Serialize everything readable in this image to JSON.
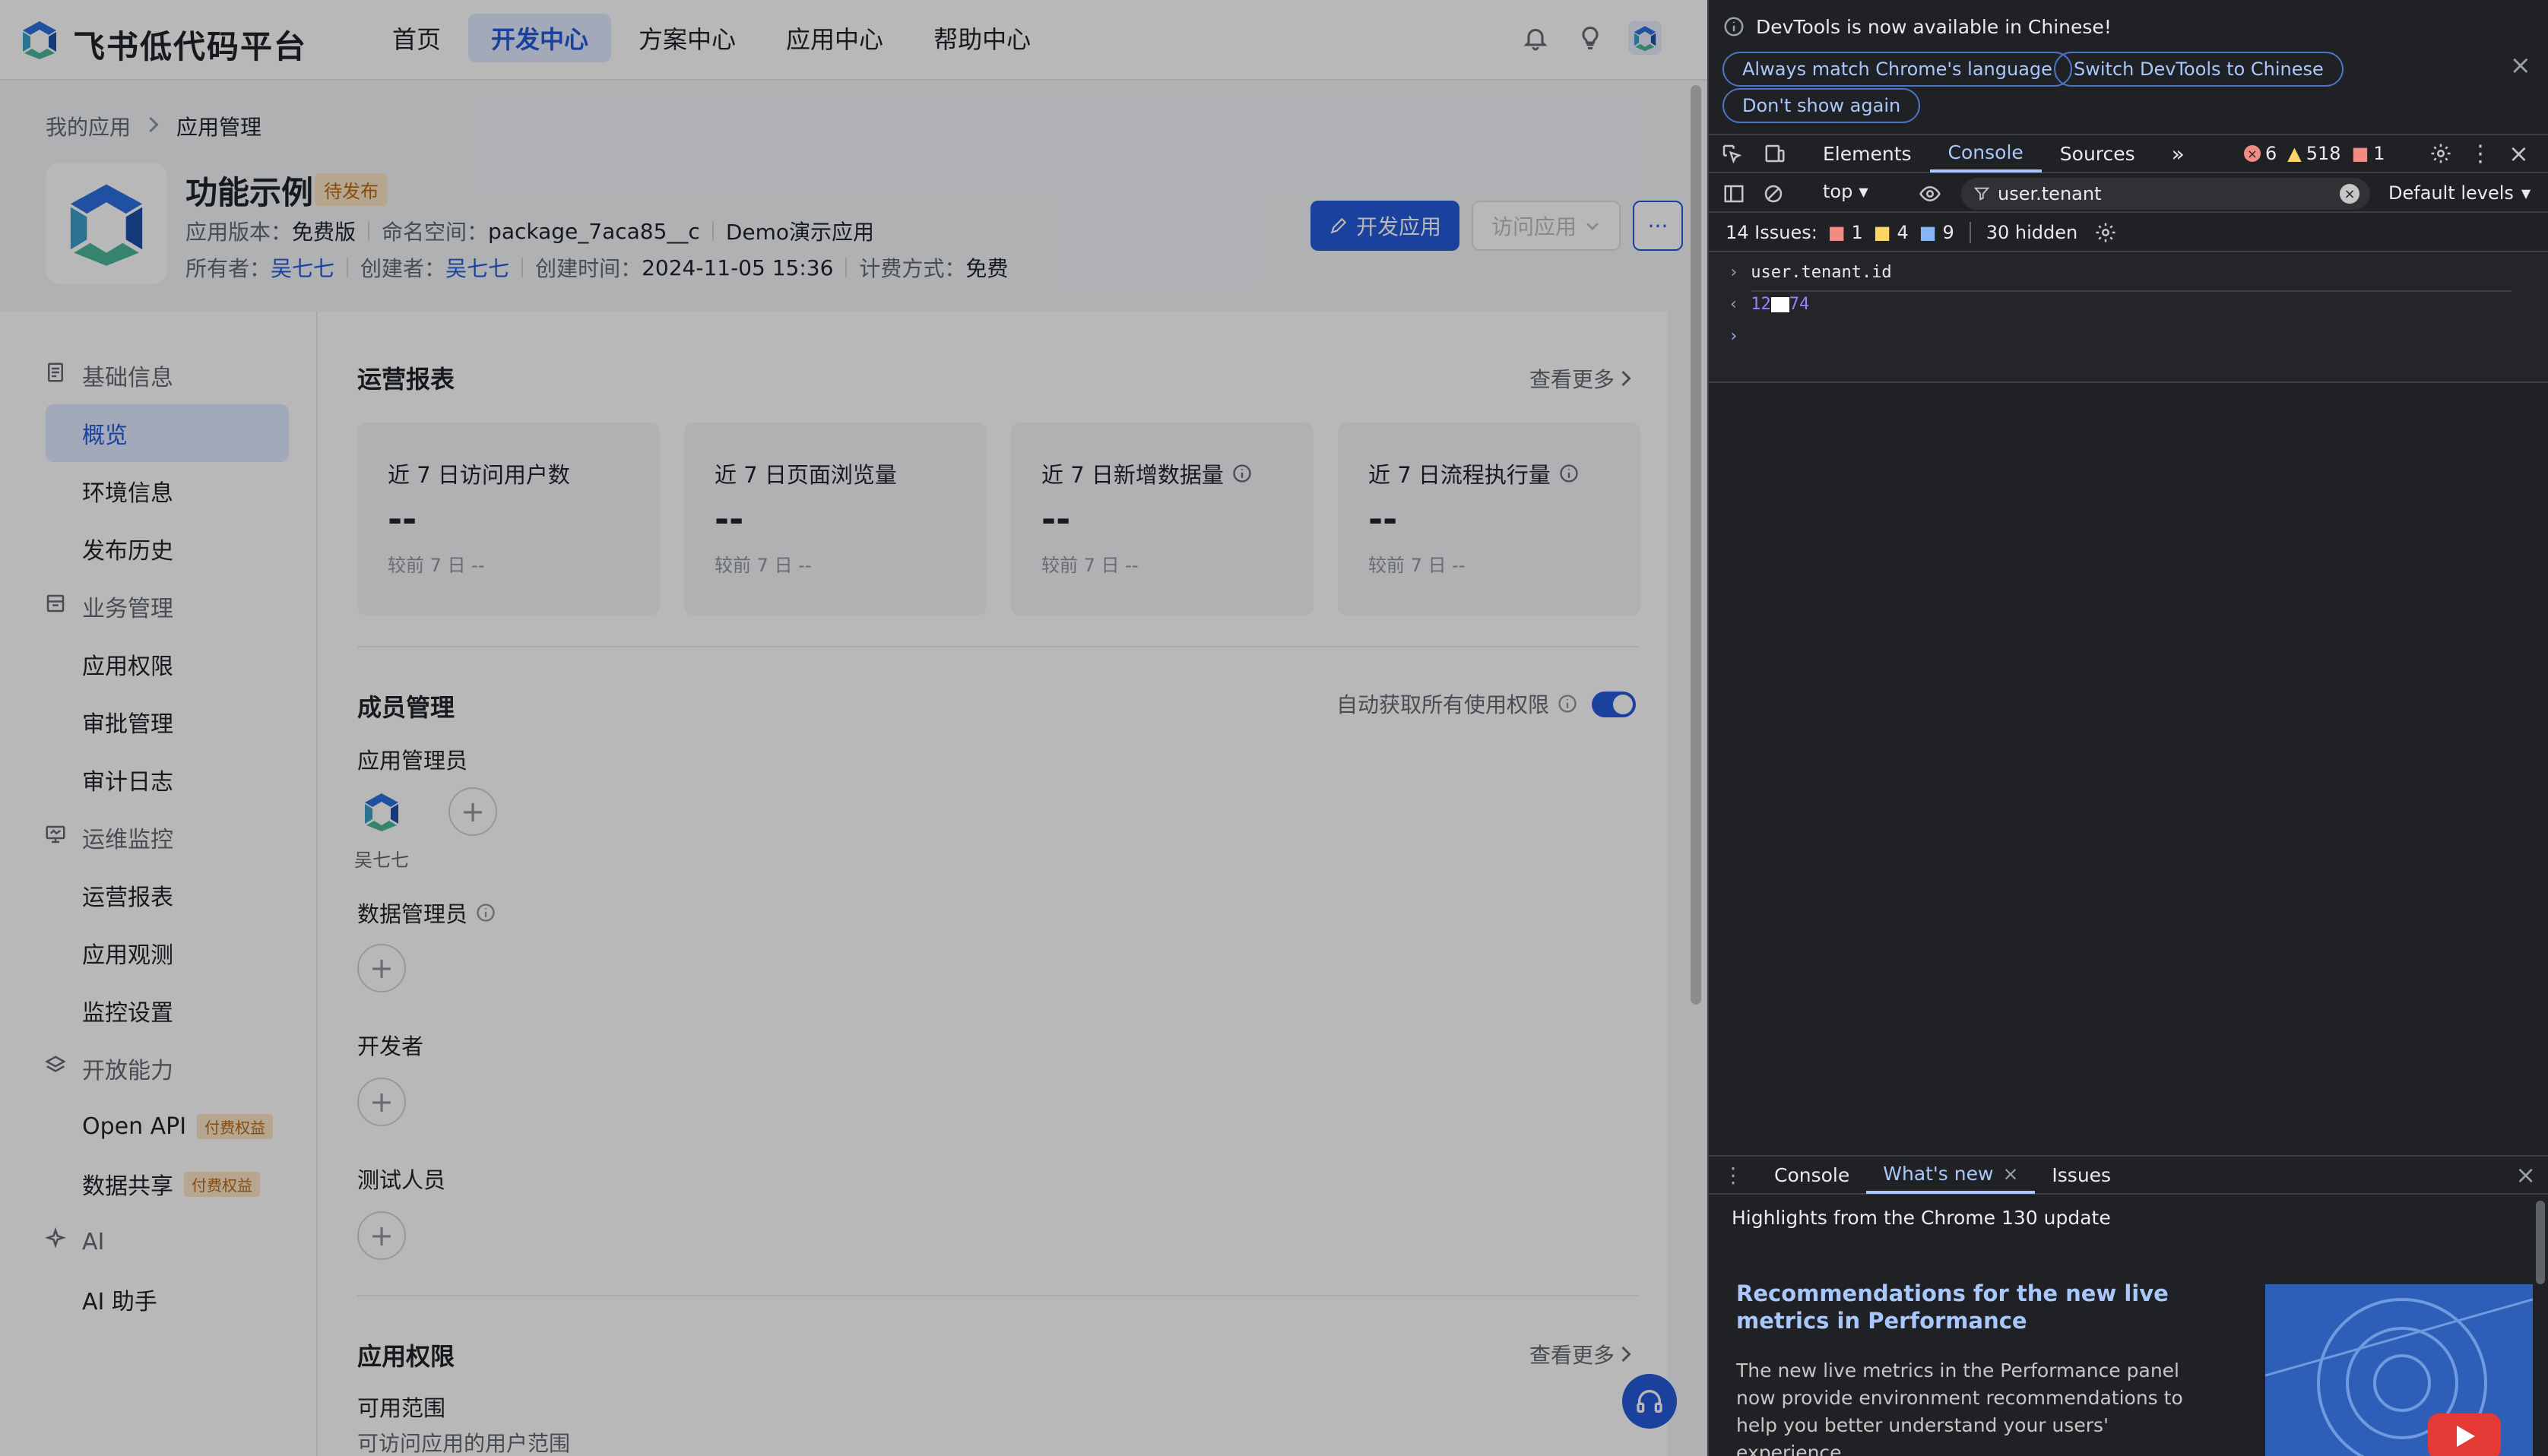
{
  "app": {
    "brand": "飞书低代码平台",
    "nav": [
      "首页",
      "开发中心",
      "方案中心",
      "应用中心",
      "帮助中心"
    ],
    "nav_active_index": 1,
    "breadcrumb": [
      "我的应用",
      "应用管理"
    ],
    "title": "功能示例",
    "status_tag": "待发布",
    "meta1": {
      "version_label": "应用版本：",
      "version": "免费版",
      "namespace_label": "命名空间：",
      "namespace": "package_7aca85__c",
      "demo": "Demo演示应用"
    },
    "meta2": {
      "owner_label": "所有者：",
      "owner": "吴七七",
      "creator_label": "创建者：",
      "creator": "吴七七",
      "created_label": "创建时间：",
      "created": "2024-11-05 15:36",
      "billing_label": "计费方式：",
      "billing": "免费"
    },
    "buttons": {
      "develop": "开发应用",
      "visit": "访问应用",
      "more": "···"
    },
    "sidebar": [
      {
        "type": "group",
        "label": "基础信息",
        "icon": "document-icon"
      },
      {
        "type": "item",
        "label": "概览",
        "active": true
      },
      {
        "type": "item",
        "label": "环境信息"
      },
      {
        "type": "item",
        "label": "发布历史"
      },
      {
        "type": "group",
        "label": "业务管理",
        "icon": "briefcase-icon"
      },
      {
        "type": "item",
        "label": "应用权限"
      },
      {
        "type": "item",
        "label": "审批管理"
      },
      {
        "type": "item",
        "label": "审计日志"
      },
      {
        "type": "group",
        "label": "运维监控",
        "icon": "monitor-icon"
      },
      {
        "type": "item",
        "label": "运营报表"
      },
      {
        "type": "item",
        "label": "应用观测"
      },
      {
        "type": "item",
        "label": "监控设置"
      },
      {
        "type": "group",
        "label": "开放能力",
        "icon": "layers-icon"
      },
      {
        "type": "item",
        "label": "Open API",
        "tag": "付费权益"
      },
      {
        "type": "item",
        "label": "数据共享",
        "tag": "付费权益"
      },
      {
        "type": "group",
        "label": "AI",
        "icon": "sparkle-icon"
      },
      {
        "type": "item",
        "label": "AI 助手"
      }
    ],
    "report": {
      "title": "运营报表",
      "more": "查看更多",
      "cards": [
        {
          "label": "近 7 日访问用户数",
          "value": "--",
          "compare": "较前 7 日  --",
          "info": false
        },
        {
          "label": "近 7 日页面浏览量",
          "value": "--",
          "compare": "较前 7 日  --",
          "info": false
        },
        {
          "label": "近 7 日新增数据量",
          "value": "--",
          "compare": "较前 7 日  --",
          "info": true
        },
        {
          "label": "近 7 日流程执行量",
          "value": "--",
          "compare": "较前 7 日  --",
          "info": true
        }
      ]
    },
    "members": {
      "title": "成员管理",
      "auto_perm": "自动获取所有使用权限",
      "auto_perm_on": true,
      "admin_label": "应用管理员",
      "admin_name": "吴七七",
      "data_admin_label": "数据管理员",
      "developer_label": "开发者",
      "tester_label": "测试人员"
    },
    "permissions": {
      "title": "应用权限",
      "more": "查看更多",
      "scope_label": "可用范围",
      "scope_desc": "可访问应用的用户范围"
    }
  },
  "devtools": {
    "info": "DevTools is now available in Chinese!",
    "pills": [
      "Always match Chrome's language",
      "Switch DevTools to Chinese",
      "Don't show again"
    ],
    "tabs": [
      "Elements",
      "Console",
      "Sources"
    ],
    "active_tab": "Console",
    "counts": {
      "errors": "6",
      "warnings": "518",
      "issues": "1"
    },
    "context": "top",
    "filter": "user.tenant",
    "levels": "Default levels",
    "issues_bar": {
      "label": "14 Issues:",
      "errors": "1",
      "warnings": "4",
      "info": "9",
      "hidden": "30 hidden"
    },
    "console": {
      "input": "user.tenant.id",
      "output_prefix": "12",
      "output_suffix": "74"
    },
    "drawer_tabs": [
      "Console",
      "What's new",
      "Issues"
    ],
    "drawer_active": "What's new",
    "whatsnew": {
      "subtitle": "Highlights from the Chrome 130 update",
      "heading": "Recommendations for the new live metrics in Performance",
      "body": "The new live metrics in the Performance panel now provide environment recommendations to help you better understand your users' experience."
    }
  }
}
